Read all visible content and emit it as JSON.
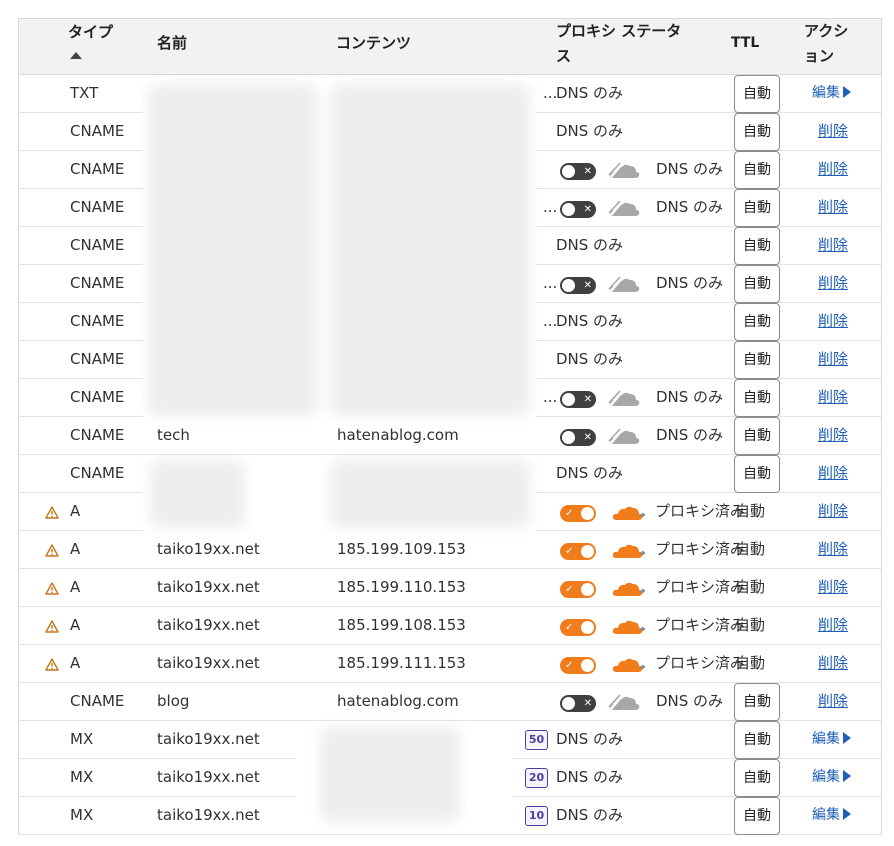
{
  "header": {
    "type_label": "タイプ",
    "name_label": "名前",
    "content_label": "コンテンツ",
    "proxy_label_line1": "プロキシ ステータ",
    "proxy_label_line2": "ス",
    "ttl_label": "TTL",
    "action_label_line1": "アクシ",
    "action_label_line2": "ョン"
  },
  "labels": {
    "ttl_auto": "自動",
    "edit": "編集",
    "delete": "削除",
    "dns_only": "DNS のみ",
    "proxied": "プロキシ済み",
    "truncated": "..."
  },
  "colors": {
    "orange": "#f07c1c",
    "link": "#1f5fb8",
    "toggle_off": "#404040"
  },
  "rows": [
    {
      "type": "TXT",
      "name": "",
      "content": "",
      "proxy": "dns-only-text",
      "trunc": true,
      "ttl": "button",
      "action": "edit"
    },
    {
      "type": "CNAME",
      "name": "",
      "content": "",
      "proxy": "dns-only-text",
      "trunc": false,
      "ttl": "button",
      "action": "delete"
    },
    {
      "type": "CNAME",
      "name": "",
      "content": "",
      "proxy": "off",
      "trunc": false,
      "ttl": "button",
      "action": "delete"
    },
    {
      "type": "CNAME",
      "name": "",
      "content": "",
      "proxy": "off",
      "trunc": true,
      "ttl": "button",
      "action": "delete"
    },
    {
      "type": "CNAME",
      "name": "",
      "content": "",
      "proxy": "dns-only-text",
      "trunc": false,
      "ttl": "button",
      "action": "delete"
    },
    {
      "type": "CNAME",
      "name": "",
      "content": "",
      "proxy": "off",
      "trunc": true,
      "ttl": "button",
      "action": "delete"
    },
    {
      "type": "CNAME",
      "name": "",
      "content": "",
      "proxy": "dns-only-text",
      "trunc": true,
      "ttl": "button",
      "action": "delete"
    },
    {
      "type": "CNAME",
      "name": "",
      "content": "",
      "proxy": "dns-only-text",
      "trunc": false,
      "ttl": "button",
      "action": "delete"
    },
    {
      "type": "CNAME",
      "name": "",
      "content": "",
      "proxy": "off",
      "trunc": true,
      "ttl": "button",
      "action": "delete"
    },
    {
      "type": "CNAME",
      "name": "tech",
      "content": "hatenablog.com",
      "proxy": "off",
      "trunc": false,
      "ttl": "button",
      "action": "delete"
    },
    {
      "type": "CNAME",
      "name": "",
      "content": "",
      "proxy": "dns-only-text",
      "trunc": false,
      "ttl": "button",
      "action": "delete"
    },
    {
      "type": "A",
      "warning": true,
      "name": "",
      "content": "",
      "proxy": "on",
      "trunc": false,
      "ttl": "text",
      "action": "delete"
    },
    {
      "type": "A",
      "warning": true,
      "name": "taiko19xx.net",
      "content": "185.199.109.153",
      "proxy": "on",
      "trunc": false,
      "ttl": "text",
      "action": "delete"
    },
    {
      "type": "A",
      "warning": true,
      "name": "taiko19xx.net",
      "content": "185.199.110.153",
      "proxy": "on",
      "trunc": false,
      "ttl": "text",
      "action": "delete"
    },
    {
      "type": "A",
      "warning": true,
      "name": "taiko19xx.net",
      "content": "185.199.108.153",
      "proxy": "on",
      "trunc": false,
      "ttl": "text",
      "action": "delete"
    },
    {
      "type": "A",
      "warning": true,
      "name": "taiko19xx.net",
      "content": "185.199.111.153",
      "proxy": "on",
      "trunc": false,
      "ttl": "text",
      "action": "delete"
    },
    {
      "type": "CNAME",
      "name": "blog",
      "content": "hatenablog.com",
      "proxy": "off",
      "trunc": false,
      "ttl": "button",
      "action": "delete"
    },
    {
      "type": "MX",
      "name": "taiko19xx.net",
      "content": "",
      "priority": "50",
      "proxy": "dns-only-text",
      "trunc": false,
      "ttl": "button",
      "action": "edit"
    },
    {
      "type": "MX",
      "name": "taiko19xx.net",
      "content": "",
      "priority": "20",
      "proxy": "dns-only-text",
      "trunc": false,
      "ttl": "button",
      "action": "edit"
    },
    {
      "type": "MX",
      "name": "taiko19xx.net",
      "content": "",
      "priority": "10",
      "proxy": "dns-only-text",
      "trunc": false,
      "ttl": "button",
      "action": "edit"
    }
  ]
}
